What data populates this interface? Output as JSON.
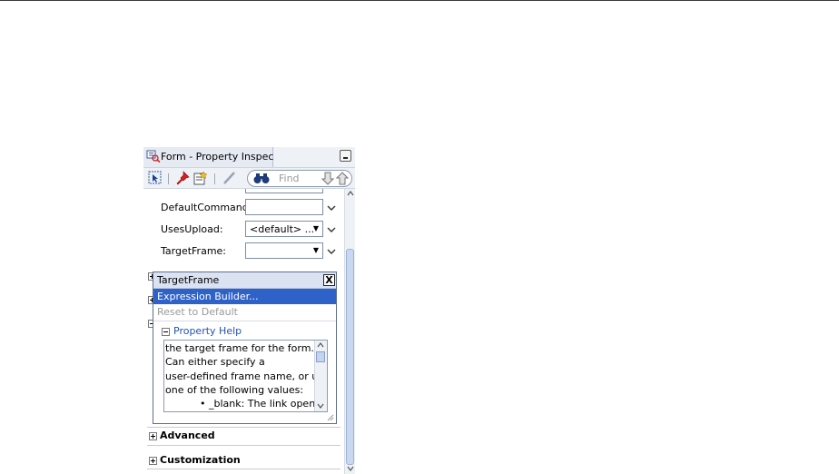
{
  "window": {
    "title": "Form - Property Inspector"
  },
  "toolbar": {
    "find_placeholder": "Find"
  },
  "properties": [
    {
      "label": "DefaultCommand:",
      "value": "",
      "has_dropdown": false
    },
    {
      "label": "UsesUpload:",
      "value": "<default> ...",
      "has_dropdown": true
    },
    {
      "label": "TargetFrame:",
      "value": "",
      "has_dropdown": true
    }
  ],
  "sections": [
    {
      "label": "Advanced"
    },
    {
      "label": "Customization"
    }
  ],
  "popup": {
    "title": "TargetFrame",
    "close_label": "X",
    "menu": [
      {
        "label": "Expression Builder...",
        "state": "selected"
      },
      {
        "label": "Reset to Default",
        "state": "disabled"
      }
    ],
    "help_header": "Property Help",
    "help_lines": [
      "the target frame for the form.",
      "Can either specify a",
      "user-defined frame name, or use",
      "one of the following values:",
      "• _blank: The link opens"
    ]
  },
  "colors": {
    "selection": "#2f62c8",
    "panel_header": "#eef1f6",
    "help_link": "#2255b0"
  }
}
